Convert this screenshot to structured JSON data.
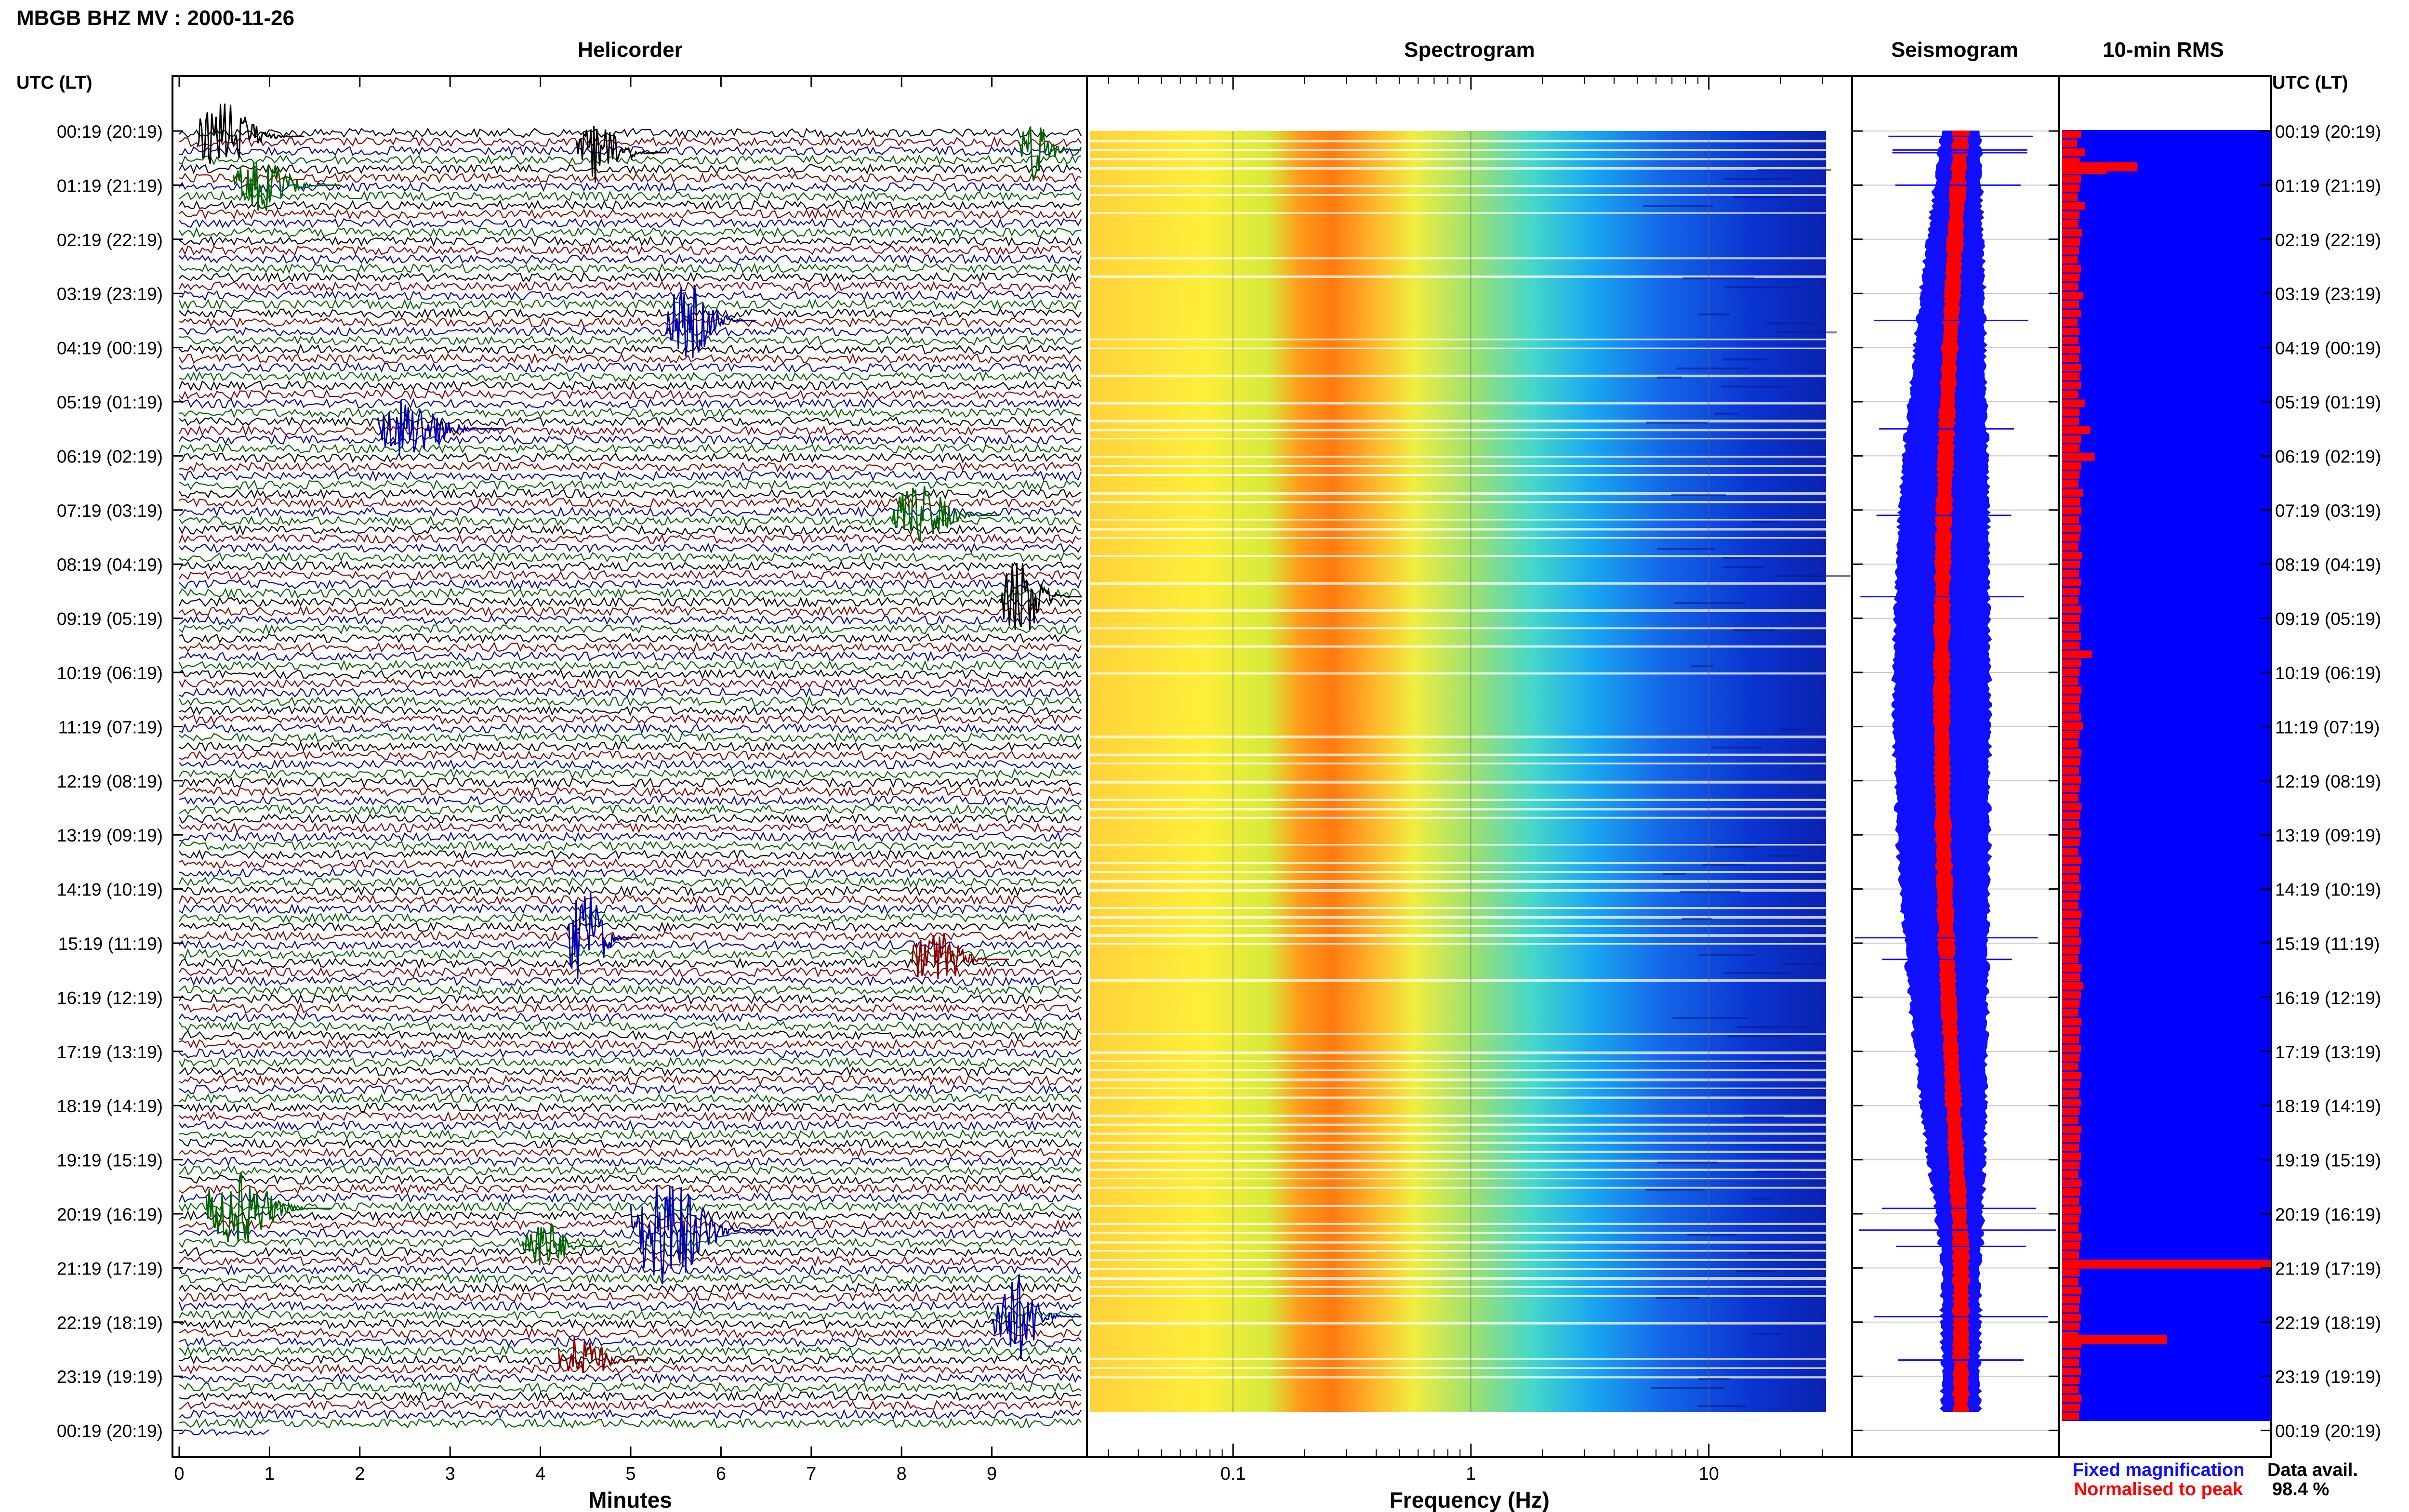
{
  "chart_data": {
    "type": "composite",
    "title": "MBGB BHZ MV : 2000-11-26",
    "time_axis_label": "UTC (LT)",
    "hour_labels": [
      "00:19 (20:19)",
      "01:19 (21:19)",
      "02:19 (22:19)",
      "03:19 (23:19)",
      "04:19 (00:19)",
      "05:19 (01:19)",
      "06:19 (02:19)",
      "07:19 (03:19)",
      "08:19 (04:19)",
      "09:19 (05:19)",
      "10:19 (06:19)",
      "11:19 (07:19)",
      "12:19 (08:19)",
      "13:19 (09:19)",
      "14:19 (10:19)",
      "15:19 (11:19)",
      "16:19 (12:19)",
      "17:19 (13:19)",
      "18:19 (14:19)",
      "19:19 (15:19)",
      "20:19 (16:19)",
      "21:19 (17:19)",
      "22:19 (18:19)",
      "23:19 (19:19)",
      "00:19 (20:19)"
    ],
    "panels": {
      "helicorder": {
        "title": "Helicorder",
        "xlabel": "Minutes",
        "xlim": [
          0,
          10
        ],
        "x_ticks": [
          "0",
          "1",
          "2",
          "3",
          "4",
          "5",
          "6",
          "7",
          "8",
          "9"
        ],
        "traces_per_hour": 6,
        "trace_colors": [
          "#000000",
          "#8b0000",
          "#0000aa",
          "#006400"
        ],
        "events": [
          {
            "hour": 0.1,
            "minute": 0.2,
            "duration": 1.2,
            "amp": 1.8,
            "color": "#000000"
          },
          {
            "hour": 0.4,
            "minute": 4.4,
            "duration": 1.0,
            "amp": 1.6,
            "color": "#000000"
          },
          {
            "hour": 0.35,
            "minute": 9.3,
            "duration": 0.9,
            "amp": 1.6,
            "color": "#006400"
          },
          {
            "hour": 1.0,
            "minute": 0.6,
            "duration": 1.2,
            "amp": 1.4,
            "color": "#006400"
          },
          {
            "hour": 3.5,
            "minute": 5.4,
            "duration": 1.0,
            "amp": 2.0,
            "color": "#0000aa"
          },
          {
            "hour": 5.5,
            "minute": 2.2,
            "duration": 1.4,
            "amp": 1.6,
            "color": "#0000aa"
          },
          {
            "hour": 7.1,
            "minute": 7.9,
            "duration": 1.2,
            "amp": 1.6,
            "color": "#006400"
          },
          {
            "hour": 8.6,
            "minute": 9.1,
            "duration": 1.0,
            "amp": 2.2,
            "color": "#000000"
          },
          {
            "hour": 14.9,
            "minute": 4.3,
            "duration": 0.8,
            "amp": 2.6,
            "color": "#0000aa"
          },
          {
            "hour": 15.3,
            "minute": 8.1,
            "duration": 1.1,
            "amp": 1.5,
            "color": "#8b0000"
          },
          {
            "hour": 19.9,
            "minute": 0.3,
            "duration": 1.4,
            "amp": 2.0,
            "color": "#006400"
          },
          {
            "hour": 20.3,
            "minute": 5.0,
            "duration": 1.6,
            "amp": 3.0,
            "color": "#0000aa"
          },
          {
            "hour": 20.6,
            "minute": 3.8,
            "duration": 0.9,
            "amp": 1.5,
            "color": "#006400"
          },
          {
            "hour": 21.9,
            "minute": 9.0,
            "duration": 1.2,
            "amp": 2.4,
            "color": "#0000aa"
          },
          {
            "hour": 22.7,
            "minute": 4.2,
            "duration": 1.0,
            "amp": 1.4,
            "color": "#8b0000"
          }
        ]
      },
      "spectrogram": {
        "title": "Spectrogram",
        "xlabel": "Frequency (Hz)",
        "x_scale": "log",
        "xlim": [
          0.025,
          40
        ],
        "x_ticks": [
          0.1,
          1,
          10
        ],
        "x_tick_labels": [
          "0.1",
          "1",
          "10"
        ],
        "colormap": "jet",
        "peak_band_hz": [
          0.18,
          0.6
        ]
      },
      "seismogram": {
        "title": "Seismogram",
        "legend": [
          {
            "label": "Fixed magnification",
            "color": "#1010ff"
          },
          {
            "label": "Normalised to peak",
            "color": "#ff0000"
          }
        ]
      },
      "rms": {
        "title": "10-min RMS",
        "bar_color": "#ff0000",
        "background_color": "#0000ff",
        "values": [
          0.3,
          0.24,
          0.36,
          0.28,
          0.72,
          0.3,
          0.28,
          0.25,
          0.36,
          0.28,
          0.26,
          0.32,
          0.29,
          0.27,
          0.25,
          0.3,
          0.28,
          0.26,
          0.34,
          0.27,
          0.3,
          0.25,
          0.28,
          0.26,
          0.29,
          0.27,
          0.31,
          0.28,
          0.3,
          0.26,
          0.36,
          0.28,
          0.27,
          0.45,
          0.3,
          0.28,
          0.52,
          0.3,
          0.28,
          0.26,
          0.33,
          0.29,
          0.31,
          0.27,
          0.3,
          0.28,
          0.26,
          0.32,
          0.29,
          0.27,
          0.3,
          0.28,
          0.26,
          0.31,
          0.29,
          0.27,
          0.3,
          0.28,
          0.48,
          0.3,
          0.28,
          0.26,
          0.31,
          0.29,
          0.27,
          0.3,
          0.33,
          0.28,
          0.26,
          0.31,
          0.29,
          0.27,
          0.3,
          0.28,
          0.26,
          0.31,
          0.29,
          0.27,
          0.3,
          0.28,
          0.26,
          0.31,
          0.29,
          0.27,
          0.3,
          0.28,
          0.26,
          0.31,
          0.29,
          0.27,
          0.3,
          0.28,
          0.26,
          0.31,
          0.29,
          0.33,
          0.3,
          0.28,
          0.26,
          0.31,
          0.29,
          0.27,
          0.3,
          0.28,
          0.26,
          0.31,
          0.29,
          0.27,
          0.3,
          0.28,
          0.26,
          0.31,
          0.29,
          0.27,
          0.3,
          0.28,
          0.26,
          0.31,
          0.29,
          0.27,
          0.3,
          0.28,
          0.26,
          0.31,
          0.29,
          0.27,
          0.3,
          0.28,
          0.26,
          0.31,
          0.29,
          0.27,
          0.3,
          0.28,
          0.26,
          0.31,
          0.29,
          0.27,
          0.3,
          0.28,
          0.26,
          0.31,
          0.29,
          0.27,
          0.3,
          0.28,
          0.26,
          0.31,
          0.29,
          0.27,
          0.3,
          0.28,
          0.26,
          0.31,
          0.29,
          0.27,
          0.3,
          0.28,
          0.26,
          0.31,
          0.29,
          0.27,
          0.3,
          0.28,
          0.26,
          0.31,
          0.29,
          0.27,
          0.3,
          0.28,
          0.26,
          0.31,
          0.29,
          0.27,
          0.3,
          0.28,
          0.26,
          0.31,
          0.29,
          0.27,
          0.3,
          0.28,
          0.26,
          0.31,
          0.29,
          0.27,
          0.3,
          0.28,
          0.26,
          0.31,
          0.29,
          0.27,
          0.3,
          0.28,
          0.26,
          0.31,
          0.29,
          0.27,
          0.3,
          0.28,
          0.26,
          0.31,
          0.29,
          0.27,
          0.3,
          0.28,
          0.26,
          0.31,
          0.29,
          0.27,
          0.3,
          0.28,
          0.26,
          0.31,
          0.29,
          0.27,
          0.3,
          0.28,
          0.34,
          0.31,
          0.29,
          0.27,
          0.3,
          0.28,
          0.26,
          0.31,
          0.29,
          0.27,
          0.3,
          0.28,
          0.26,
          0.31,
          0.29,
          0.27,
          0.3,
          0.28,
          0.26,
          0.31,
          0.29,
          0.27,
          0.3,
          0.28,
          0.26,
          0.31,
          0.29,
          0.27,
          0.3,
          0.28,
          0.26,
          0.31,
          0.29,
          0.27,
          0.3,
          0.28,
          0.26,
          0.31,
          0.29,
          0.27,
          0.3,
          0.28,
          0.26,
          0.31,
          0.29,
          0.27,
          0.3,
          0.28,
          0.26,
          0.31,
          0.29,
          0.27,
          0.3,
          0.28,
          0.26,
          0.31,
          0.29,
          0.27,
          0.3,
          0.28,
          0.26,
          0.31,
          0.29,
          0.27,
          0.3,
          0.28,
          0.26,
          0.31,
          0.29,
          0.27,
          0.3,
          0.28,
          0.26,
          0.31,
          0.29,
          0.27,
          0.3,
          0.28,
          0.26,
          0.31,
          0.29,
          0.27,
          0.3,
          0.28,
          0.26,
          0.31,
          0.29,
          0.27,
          0.3,
          0.28,
          0.26,
          0.31,
          0.29,
          0.27,
          0.3,
          0.28,
          0.26,
          0.31,
          0.29,
          0.27,
          0.3,
          0.28,
          0.26,
          0.31,
          0.29,
          0.27,
          0.3,
          0.28,
          0.26,
          0.31,
          0.29,
          0.27,
          0.3,
          0.28,
          0.26,
          0.31,
          0.29,
          0.27,
          0.3,
          0.28,
          0.26,
          0.31,
          0.29,
          0.27,
          0.3,
          0.28,
          0.26,
          0.31,
          0.29,
          0.27,
          0.3,
          0.28,
          0.26,
          0.31,
          0.29,
          0.27,
          0.3,
          0.28,
          0.26,
          0.31,
          0.29,
          0.27,
          0.3,
          0.28,
          0.26,
          0.31,
          0.29,
          0.27,
          0.3,
          0.28,
          0.26,
          0.31,
          0.29,
          0.27,
          0.3,
          0.28,
          0.26,
          0.31,
          0.29,
          0.27,
          0.3,
          0.28,
          0.26,
          0.31,
          0.29,
          0.27,
          0.3,
          0.28,
          0.26,
          0.31,
          0.29,
          0.27,
          0.3,
          0.28,
          0.26,
          0.31,
          0.29,
          0.27,
          0.3,
          0.28,
          0.26,
          0.31,
          0.29,
          0.27,
          0.3,
          0.28,
          0.26,
          0.31,
          0.29,
          0.27,
          0.3,
          0.28,
          0.26,
          0.31,
          0.29,
          0.27,
          0.3,
          0.28,
          0.26,
          0.31,
          0.29,
          0.27,
          0.3,
          0.28,
          0.26,
          0.31,
          0.29,
          0.27,
          0.3,
          0.28,
          0.26,
          0.31,
          0.29,
          0.27,
          0.3,
          0.28,
          0.26,
          0.31,
          0.29,
          0.27,
          0.3,
          0.28,
          0.26,
          0.31,
          0.29,
          0.27,
          0.3,
          0.28,
          0.26,
          0.31,
          0.29,
          0.27,
          0.3,
          0.28,
          0.26,
          0.31,
          0.29,
          0.27,
          0.3,
          0.28,
          0.26,
          0.31,
          0.29,
          0.27,
          0.3,
          0.28,
          0.26,
          0.31,
          0.29,
          0.27,
          0.3,
          0.28,
          0.26,
          0.31,
          0.29,
          0.27,
          0.3,
          0.28,
          0.26,
          0.31,
          0.29,
          0.27,
          0.3,
          0.28,
          0.26,
          0.31,
          0.29,
          0.27,
          0.3,
          0.28,
          0.26,
          0.31,
          0.29,
          0.27,
          0.3,
          0.28,
          0.26,
          0.31,
          0.29,
          0.27,
          0.3,
          0.28,
          0.26,
          0.31,
          0.29,
          0.27
        ],
        "notable": [
          {
            "hour": 0.6,
            "value": 0.72
          },
          {
            "hour": 21.0,
            "value": 2.0
          },
          {
            "hour": 22.4,
            "value": 1.0
          }
        ]
      }
    },
    "data_availability_label": "Data avail.",
    "data_availability": "98.4 %"
  }
}
